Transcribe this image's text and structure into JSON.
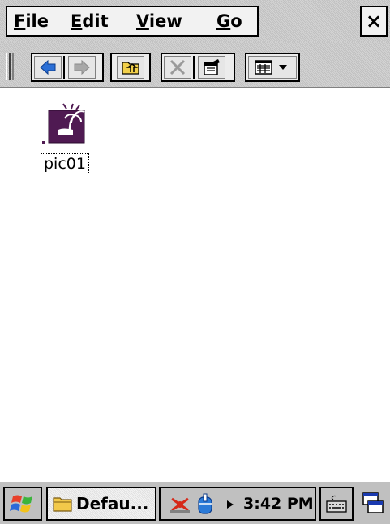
{
  "menubar": {
    "file_label": "File",
    "edit_label": "Edit",
    "view_label": "View",
    "go_label": "Go",
    "close_label": "×"
  },
  "toolbar": {
    "buttons": [
      "back-icon",
      "forward-icon",
      "up-folder-icon",
      "delete-icon",
      "properties-icon",
      "view-mode-icon"
    ]
  },
  "files": [
    {
      "name": "pic01",
      "icon": "image-file-icon"
    }
  ],
  "taskbar": {
    "start_icon": "windows-flag-icon",
    "task_label": "Defau...",
    "clock": "3:42 PM",
    "tray_icons": [
      "network-icon",
      "usb-icon",
      "tray-arrow-icon"
    ],
    "keyboard_icon": "keyboard-icon",
    "switch_icon": "window-switch-icon"
  },
  "colors": {
    "chrome": "#c0c0c0",
    "toolbar_arrow": "#2b6fd6",
    "icon_purple": "#5a1a5c"
  }
}
